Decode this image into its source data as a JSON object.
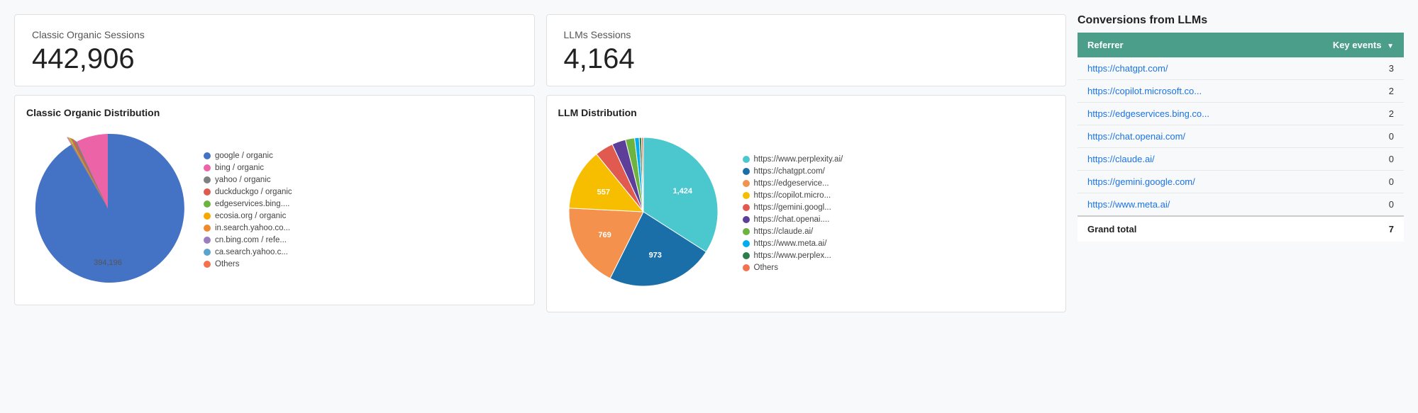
{
  "metrics": {
    "classic_sessions": {
      "label": "Classic Organic Sessions",
      "value": "442,906"
    },
    "llm_sessions": {
      "label": "LLMs Sessions",
      "value": "4,164"
    }
  },
  "classic_chart": {
    "title": "Classic Organic Distribution",
    "slices": [
      {
        "label": "google / organic",
        "color": "#4472C4",
        "pct": 89,
        "value": 394196
      },
      {
        "label": "bing / organic",
        "color": "#ED63A8",
        "pct": 4,
        "value": null
      },
      {
        "label": "yahoo / organic",
        "color": "#808080",
        "pct": 1.5,
        "value": null
      },
      {
        "label": "duckduckgo / organic",
        "color": "#E05A4F",
        "pct": 1.5,
        "value": null
      },
      {
        "label": "edgeservices.bing....",
        "color": "#6DB33F",
        "pct": 0.5,
        "value": null
      },
      {
        "label": "ecosia.org / organic",
        "color": "#F7A800",
        "pct": 1.2,
        "value": null
      },
      {
        "label": "in.search.yahoo.co...",
        "color": "#EE8A2E",
        "pct": 0.8,
        "value": null
      },
      {
        "label": "cn.bing.com / refe...",
        "color": "#9B7EBD",
        "pct": 0.8,
        "value": null
      },
      {
        "label": "ca.search.yahoo.c...",
        "color": "#5BA4CF",
        "pct": 0.4,
        "value": null
      },
      {
        "label": "Others",
        "color": "#F4714D",
        "pct": 0.3,
        "value": null
      }
    ],
    "center_label": "394,196"
  },
  "llm_chart": {
    "title": "LLM Distribution",
    "slices": [
      {
        "label": "https://www.perplexity.ai/",
        "color": "#4BC8CE",
        "pct": 34.2,
        "value": 1424
      },
      {
        "label": "https://chatgpt.com/",
        "color": "#1A6FA8",
        "pct": 23.4,
        "value": 973
      },
      {
        "label": "https://edgeservice...",
        "color": "#F4914D",
        "pct": 18.5,
        "value": 769
      },
      {
        "label": "https://copilot.micro...",
        "color": "#F7BE00",
        "pct": 13.4,
        "value": 557
      },
      {
        "label": "https://gemini.googl...",
        "color": "#E05A4F",
        "pct": 4,
        "value": null
      },
      {
        "label": "https://chat.openai....",
        "color": "#5D3F99",
        "pct": 3,
        "value": null
      },
      {
        "label": "https://claude.ai/",
        "color": "#6DB33F",
        "pct": 2,
        "value": null
      },
      {
        "label": "https://www.meta.ai/",
        "color": "#00ADEF",
        "pct": 1,
        "value": null
      },
      {
        "label": "https://www.perplex...",
        "color": "#2B7D4B",
        "pct": 0.5,
        "value": null
      },
      {
        "label": "Others",
        "color": "#F4714D",
        "pct": 0.4,
        "value": null
      }
    ]
  },
  "conversions": {
    "title": "Conversions from LLMs",
    "header": {
      "referrer": "Referrer",
      "key_events": "Key events"
    },
    "rows": [
      {
        "referrer": "https://chatgpt.com/",
        "key_events": "3"
      },
      {
        "referrer": "https://copilot.microsoft.co...",
        "key_events": "2"
      },
      {
        "referrer": "https://edgeservices.bing.co...",
        "key_events": "2"
      },
      {
        "referrer": "https://chat.openai.com/",
        "key_events": "0"
      },
      {
        "referrer": "https://claude.ai/",
        "key_events": "0"
      },
      {
        "referrer": "https://gemini.google.com/",
        "key_events": "0"
      },
      {
        "referrer": "https://www.meta.ai/",
        "key_events": "0"
      }
    ],
    "footer": {
      "label": "Grand total",
      "value": "7"
    }
  }
}
